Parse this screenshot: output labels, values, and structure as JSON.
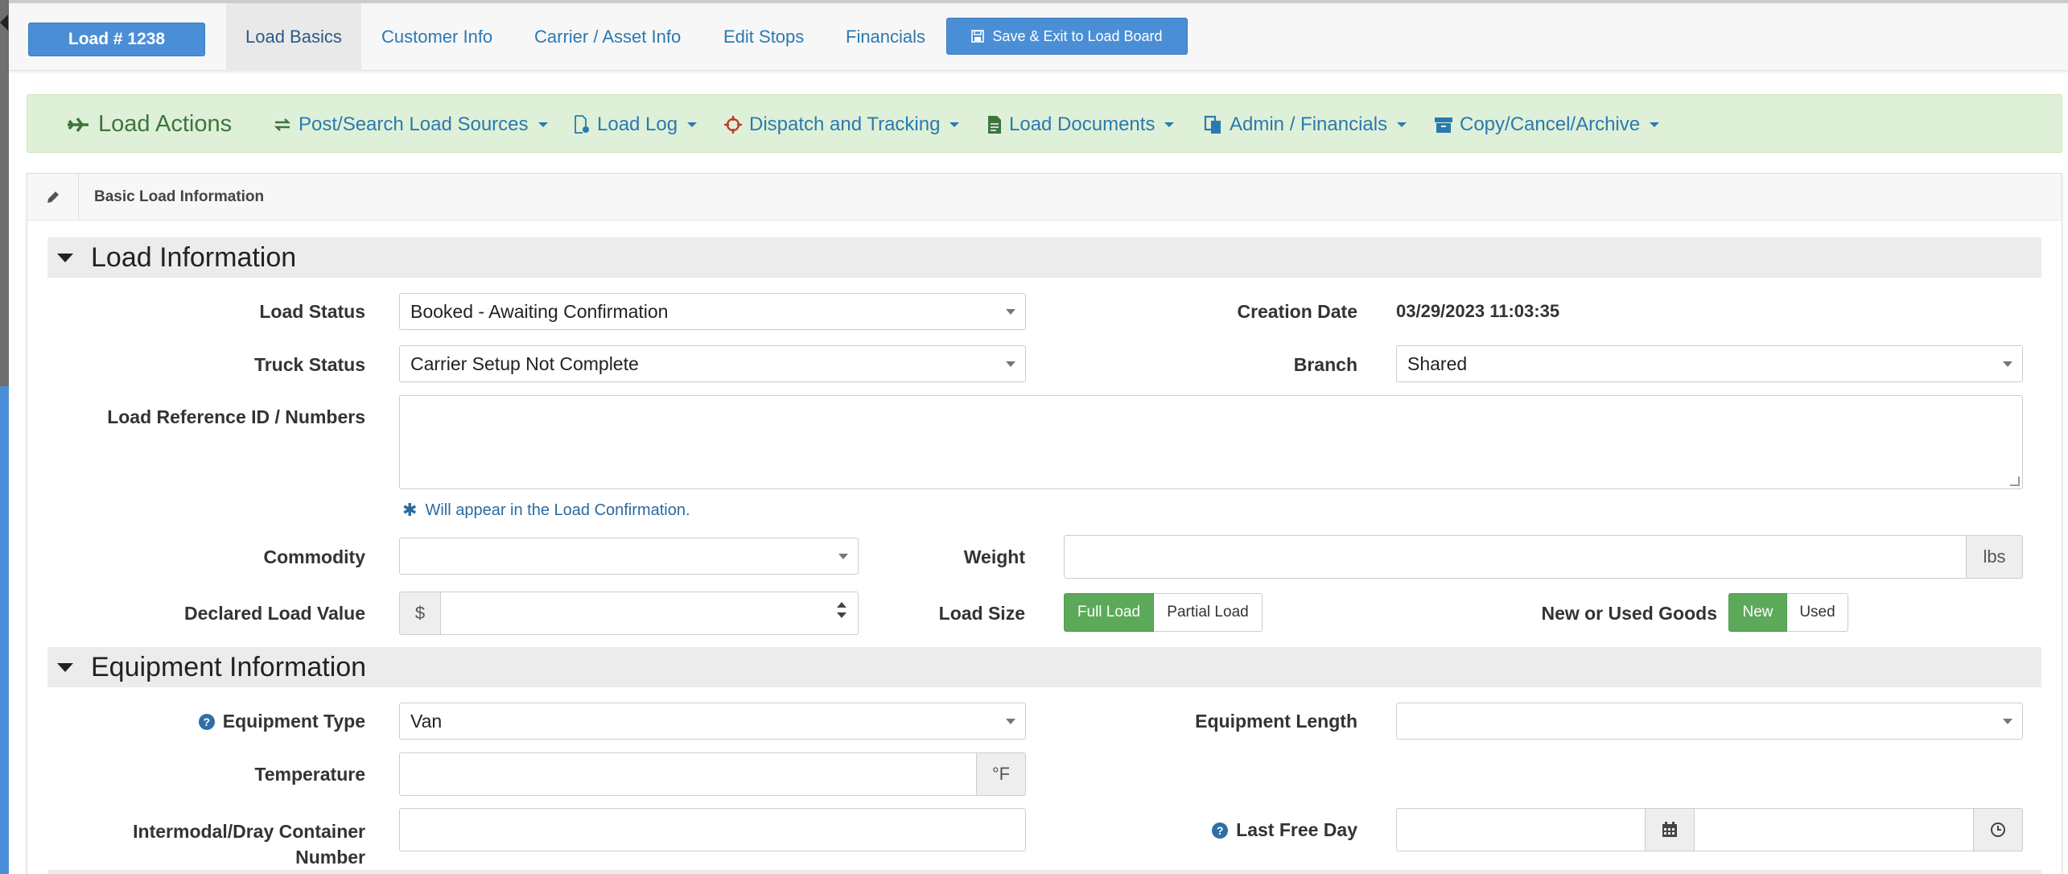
{
  "nav": {
    "load_badge": "Load # 1238",
    "tabs": [
      {
        "label": "Load Basics"
      },
      {
        "label": "Customer Info"
      },
      {
        "label": "Carrier / Asset Info"
      },
      {
        "label": "Edit Stops"
      },
      {
        "label": "Financials"
      }
    ],
    "save_label": "Save & Exit to Load Board"
  },
  "actions": {
    "title": "Load Actions",
    "items": [
      {
        "label": "Post/Search Load Sources",
        "icon": "refresh-icon"
      },
      {
        "label": "Load Log",
        "icon": "file-icon"
      },
      {
        "label": "Dispatch and Tracking",
        "icon": "crosshair-icon"
      },
      {
        "label": "Load Documents",
        "icon": "document-icon"
      },
      {
        "label": "Admin / Financials",
        "icon": "copy-icon"
      },
      {
        "label": "Copy/Cancel/Archive",
        "icon": "archive-icon"
      }
    ]
  },
  "panel": {
    "title": "Basic Load Information"
  },
  "load_info": {
    "section_title": "Load Information",
    "load_status_label": "Load Status",
    "load_status_value": "Booked - Awaiting Confirmation",
    "creation_date_label": "Creation Date",
    "creation_date_value": "03/29/2023 11:03:35",
    "truck_status_label": "Truck Status",
    "truck_status_value": "Carrier Setup Not Complete",
    "branch_label": "Branch",
    "branch_value": "Shared",
    "ref_label": "Load Reference ID / Numbers",
    "ref_value": "",
    "ref_help": "Will appear in the Load Confirmation.",
    "commodity_label": "Commodity",
    "commodity_value": "",
    "weight_label": "Weight",
    "weight_value": "",
    "weight_unit": "lbs",
    "declared_label": "Declared Load Value",
    "currency": "$",
    "declared_value": "",
    "load_size_label": "Load Size",
    "load_size_options": [
      "Full Load",
      "Partial Load"
    ],
    "load_size_selected": "Full Load",
    "goods_label": "New or Used Goods",
    "goods_options": [
      "New",
      "Used"
    ],
    "goods_selected": "New"
  },
  "equipment": {
    "section_title": "Equipment Information",
    "type_label": "Equipment Type",
    "type_value": "Van",
    "length_label": "Equipment Length",
    "length_value": "",
    "temp_label": "Temperature",
    "temp_value": "",
    "temp_unit": "°F",
    "container_label_1": "Intermodal/Dray Container",
    "container_label_2": "Number",
    "container_value": "",
    "last_free_label": "Last Free Day",
    "last_free_date": "",
    "last_free_time": ""
  },
  "colors": {
    "primary": "#4a8fd6",
    "link": "#2a7ab0",
    "success": "#5ca95a",
    "actions_bg": "#dff0d8"
  }
}
